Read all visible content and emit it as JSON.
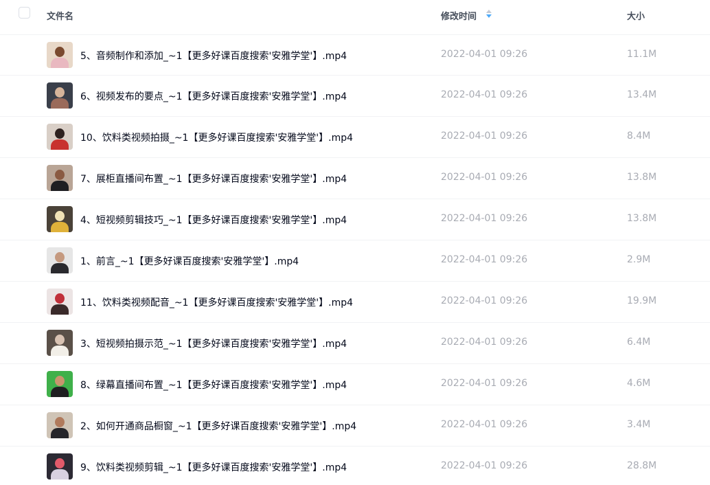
{
  "header": {
    "name_label": "文件名",
    "time_label": "修改时间",
    "size_label": "大小"
  },
  "accent": "#4da9f8",
  "files": [
    {
      "name": "5、音频制作和添加_~1【更多好课百度搜索'安雅学堂'】.mp4",
      "time": "2022-04-01 09:26",
      "size": "11.1M"
    },
    {
      "name": "6、视频发布的要点_~1【更多好课百度搜索'安雅学堂'】.mp4",
      "time": "2022-04-01 09:26",
      "size": "13.4M"
    },
    {
      "name": "10、饮料类视频拍摄_~1【更多好课百度搜索'安雅学堂'】.mp4",
      "time": "2022-04-01 09:26",
      "size": "8.4M"
    },
    {
      "name": "7、展柜直播间布置_~1【更多好课百度搜索'安雅学堂'】.mp4",
      "time": "2022-04-01 09:26",
      "size": "13.8M"
    },
    {
      "name": "4、短视频剪辑技巧_~1【更多好课百度搜索'安雅学堂'】.mp4",
      "time": "2022-04-01 09:26",
      "size": "13.8M"
    },
    {
      "name": "1、前言_~1【更多好课百度搜索'安雅学堂'】.mp4",
      "time": "2022-04-01 09:26",
      "size": "2.9M"
    },
    {
      "name": "11、饮料类视频配音_~1【更多好课百度搜索'安雅学堂'】.mp4",
      "time": "2022-04-01 09:26",
      "size": "19.9M"
    },
    {
      "name": "3、短视频拍摄示范_~1【更多好课百度搜索'安雅学堂'】.mp4",
      "time": "2022-04-01 09:26",
      "size": "6.4M"
    },
    {
      "name": "8、绿幕直播间布置_~1【更多好课百度搜索'安雅学堂'】.mp4",
      "time": "2022-04-01 09:26",
      "size": "4.6M"
    },
    {
      "name": "2、如何开通商品橱窗_~1【更多好课百度搜索'安雅学堂'】.mp4",
      "time": "2022-04-01 09:26",
      "size": "3.4M"
    },
    {
      "name": "9、饮料类视频剪辑_~1【更多好课百度搜索'安雅学堂'】.mp4",
      "time": "2022-04-01 09:26",
      "size": "28.8M"
    }
  ]
}
